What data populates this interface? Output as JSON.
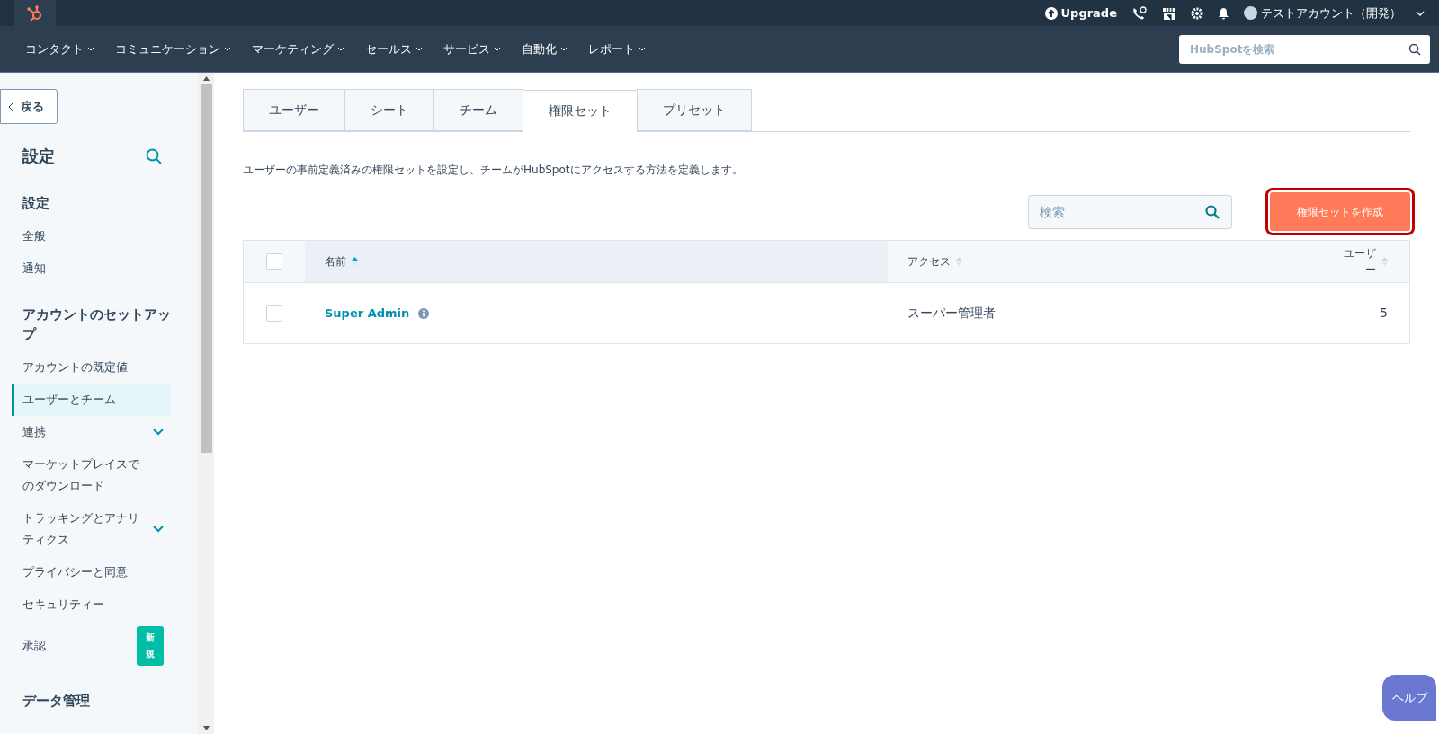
{
  "top_bar": {
    "upgrade": "Upgrade",
    "account": "テストアカウント（開発）"
  },
  "nav": {
    "items": [
      "コンタクト",
      "コミュニケーション",
      "マーケティング",
      "セールス",
      "サービス",
      "自動化",
      "レポート"
    ],
    "search": {
      "placeholder": "HubSpotを検索"
    }
  },
  "sidebar": {
    "back": "戻る",
    "title": "設定",
    "sections": [
      {
        "heading": "設定",
        "items": [
          {
            "label": "全般",
            "selected": false,
            "expandable": false
          },
          {
            "label": "通知",
            "selected": false,
            "expandable": false
          }
        ]
      },
      {
        "heading": "アカウントのセットアップ",
        "items": [
          {
            "label": "アカウントの既定値",
            "selected": false,
            "expandable": false
          },
          {
            "label": "ユーザーとチーム",
            "selected": true,
            "expandable": false
          },
          {
            "label": "連携",
            "selected": false,
            "expandable": true
          },
          {
            "label": "マーケットプレイスでのダウンロード",
            "selected": false,
            "expandable": false
          },
          {
            "label": "トラッキングとアナリティクス",
            "selected": false,
            "expandable": true
          },
          {
            "label": "プライバシーと同意",
            "selected": false,
            "expandable": false
          },
          {
            "label": "セキュリティー",
            "selected": false,
            "expandable": false
          },
          {
            "label": "承認",
            "selected": false,
            "expandable": false,
            "badge": "新規"
          }
        ]
      },
      {
        "heading": "データ管理"
      }
    ]
  },
  "tabs": [
    {
      "label": "ユーザー",
      "selected": false
    },
    {
      "label": "シート",
      "selected": false
    },
    {
      "label": "チーム",
      "selected": false
    },
    {
      "label": "権限セット",
      "selected": true
    },
    {
      "label": "プリセット",
      "selected": false
    }
  ],
  "description": "ユーザーの事前定義済みの権限セットを設定し、チームがHubSpotにアクセスする方法を定義します。",
  "search": {
    "placeholder": "検索"
  },
  "create_button": {
    "label": "権限セットを作成",
    "highlighted": true
  },
  "table": {
    "all_checked": false,
    "columns": [
      {
        "label": "名前",
        "sorted": true
      },
      {
        "label": "アクセス",
        "sorted": false
      },
      {
        "label": "ユーザー",
        "sorted": false
      }
    ],
    "rows": [
      {
        "name": "Super Admin",
        "access": "スーパー管理者",
        "users": "5",
        "checked": false
      }
    ]
  },
  "help": "ヘルプ"
}
